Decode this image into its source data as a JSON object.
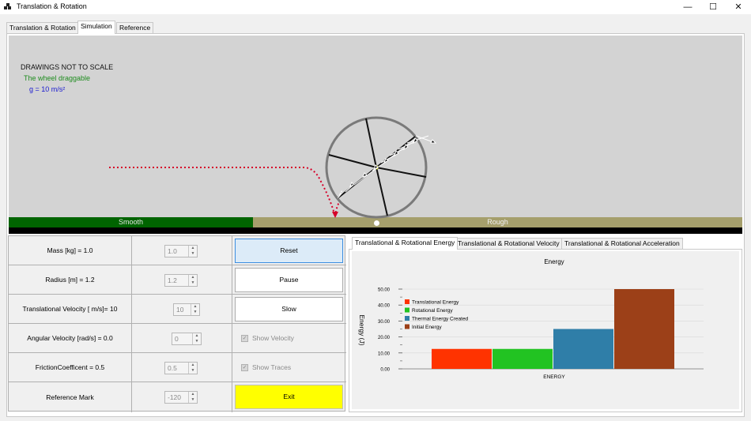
{
  "window": {
    "title": "Translation & Rotation",
    "minimize": "—",
    "maximize": "☐",
    "close": "✕"
  },
  "tabs": [
    {
      "label": "Translation & Rotation",
      "active": false
    },
    {
      "label": "Simulation",
      "active": true
    },
    {
      "label": "Reference",
      "active": false
    }
  ],
  "simulation": {
    "note_scale": "DRAWINGS NOT TO SCALE",
    "note_drag": "The wheel draggable",
    "gravity": "g  =  10 m/s²",
    "surface_left": "Smooth",
    "surface_right": "Rough",
    "colors": {
      "background": "#d3d3d3",
      "smooth": "#006400",
      "rough": "#a59f6c",
      "trace": "#d6002a"
    }
  },
  "controls": {
    "rows": [
      {
        "label": "Mass [kg] = 1.0",
        "spin_value": "1.0",
        "action": {
          "type": "button",
          "label": "Reset",
          "focused": true
        }
      },
      {
        "label": "Radius [m] = 1.2",
        "spin_value": "1.2",
        "action": {
          "type": "button",
          "label": "Pause"
        }
      },
      {
        "label": "Translational Velocity [ m/s]= 10",
        "spin_value": "10",
        "action": {
          "type": "button",
          "label": "Slow"
        }
      },
      {
        "label": "Angular Velocity [rad/s] = 0.0",
        "spin_value": "0",
        "action": {
          "type": "checkbox",
          "label": "Show Velocity",
          "checked": true
        }
      },
      {
        "label": "FrictionCoefficent = 0.5",
        "spin_value": "0.5",
        "action": {
          "type": "checkbox",
          "label": "Show Traces",
          "checked": true
        }
      },
      {
        "label": "Reference Mark",
        "spin_value": "-120",
        "action": {
          "type": "button",
          "label": "Exit",
          "exit": true
        }
      }
    ]
  },
  "chart_tabs": [
    {
      "label": "Translational & Rotational Energy",
      "active": true
    },
    {
      "label": "Translational & Rotational Velocity",
      "active": false
    },
    {
      "label": "Translational & Rotational Acceleration",
      "active": false
    }
  ],
  "chart_data": {
    "type": "bar",
    "title": "Energy",
    "xlabel": "ENERGY",
    "ylabel": "Energy (J)",
    "ylim": [
      0,
      50
    ],
    "yticks": [
      "0.00",
      "10.00",
      "20.00",
      "30.00",
      "40.00",
      "50.00"
    ],
    "grid": true,
    "legend_position": "top-left",
    "series": [
      {
        "name": "Translational Energy",
        "value": 12.5,
        "color": "#ff3300"
      },
      {
        "name": "Rotational Energy",
        "value": 12.5,
        "color": "#22c322"
      },
      {
        "name": "Thermal Energy Created",
        "value": 25.0,
        "color": "#2f7ea8"
      },
      {
        "name": "Initial Energy",
        "value": 50.0,
        "color": "#9c4018"
      }
    ]
  }
}
